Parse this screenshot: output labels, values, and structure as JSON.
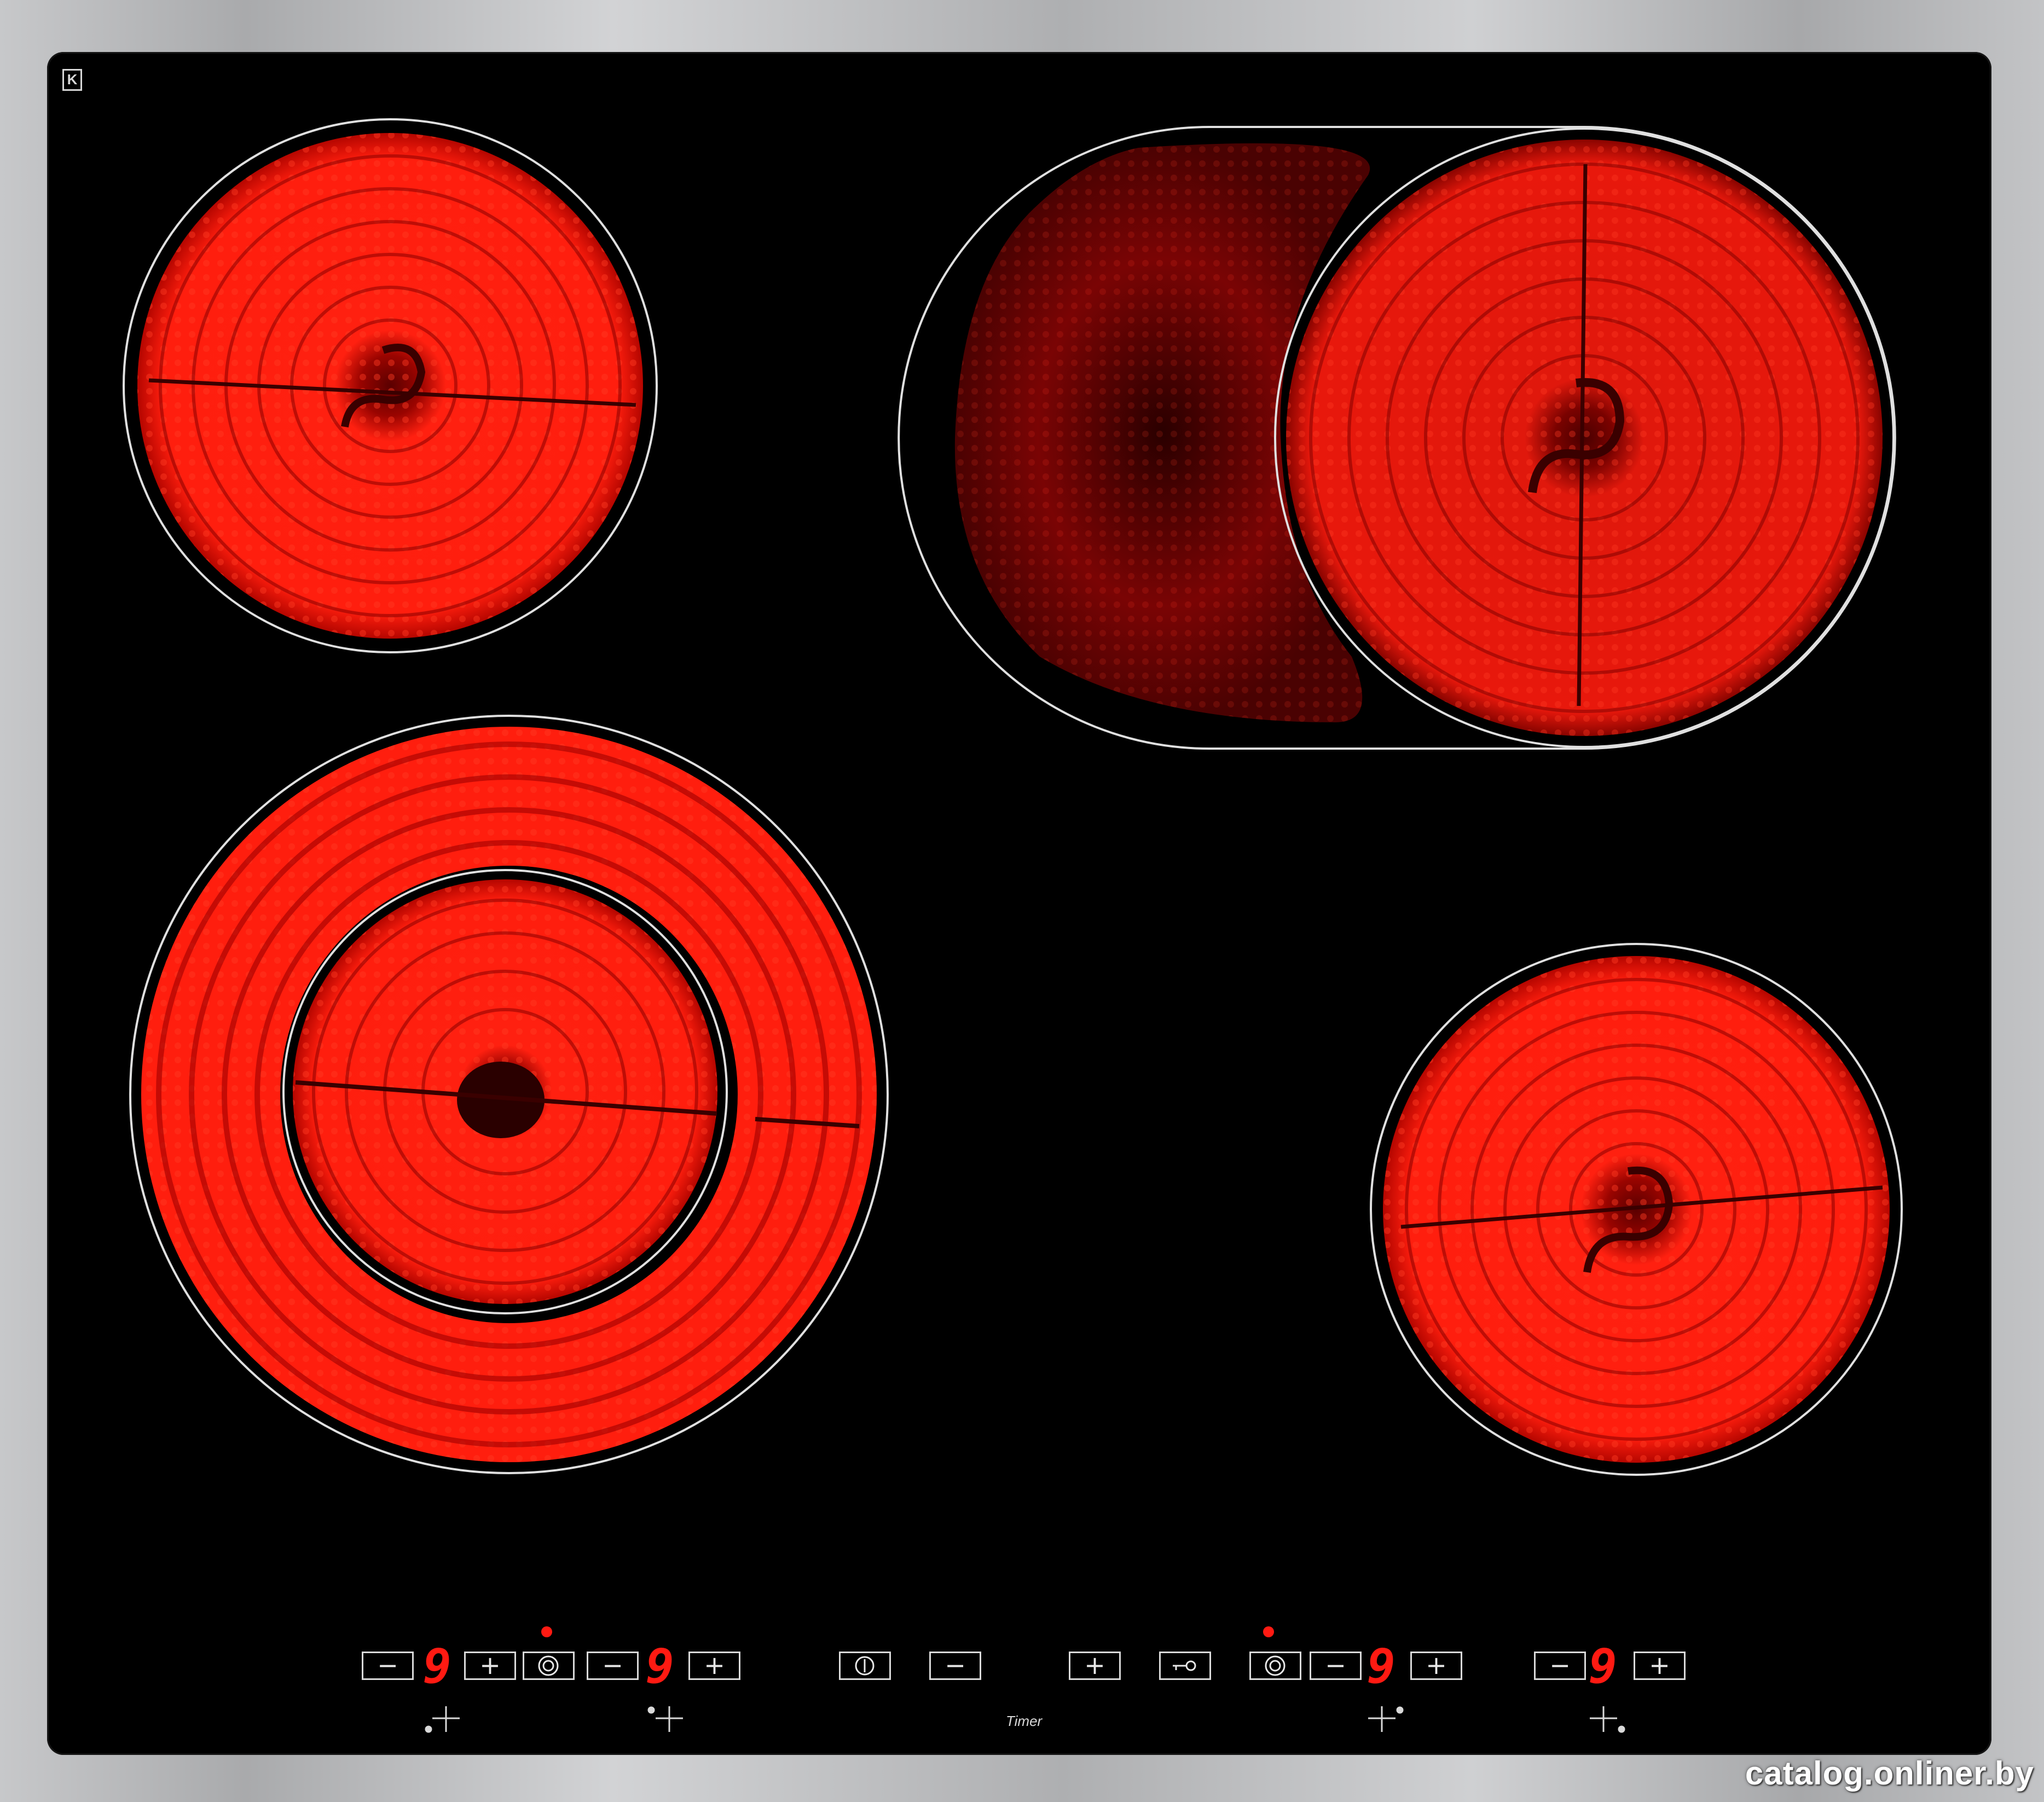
{
  "brand_badge": "K",
  "watermark": "catalog.onliner.by",
  "controls": {
    "minus": "−",
    "plus": "+",
    "power_icon": "power-icon",
    "lock_icon": "key-lock-icon",
    "dual_zone_icon": "dual-zone-icon",
    "timer_label": "Timer",
    "display_digit": "9"
  },
  "colors": {
    "glass": "#000000",
    "heat_glow": "#ff1a12",
    "zone_outline": "#e0e0e0",
    "frame": "#b9babc"
  }
}
